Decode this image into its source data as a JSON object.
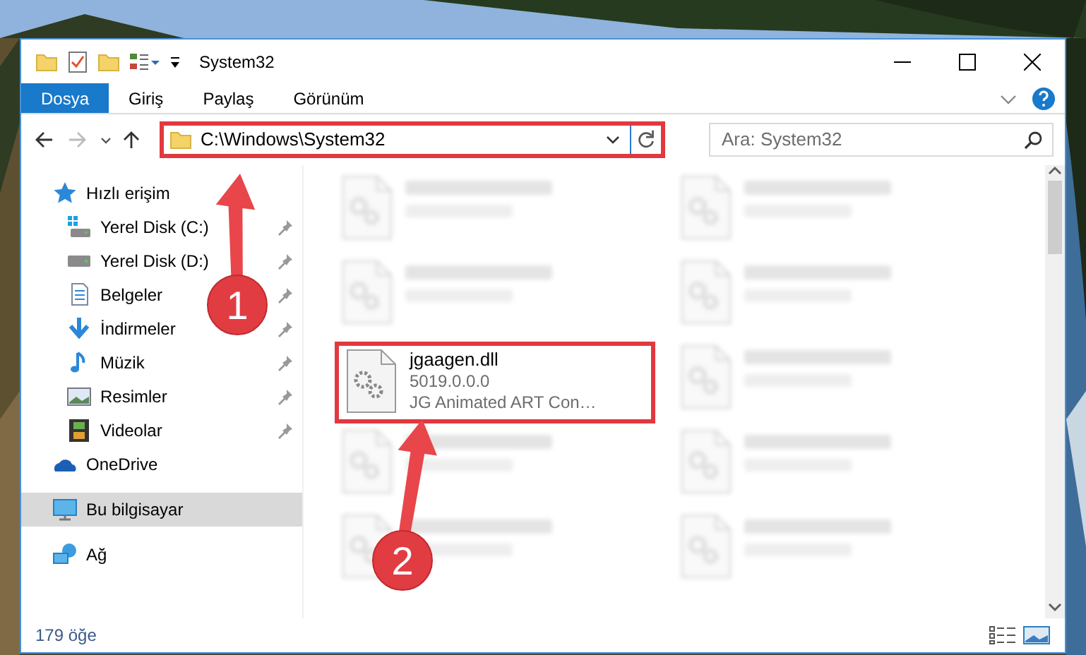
{
  "window": {
    "title": "System32"
  },
  "ribbon_tabs": [
    {
      "label": "Dosya",
      "selected": true
    },
    {
      "label": "Giriş",
      "selected": false
    },
    {
      "label": "Paylaş",
      "selected": false
    },
    {
      "label": "Görünüm",
      "selected": false
    }
  ],
  "address": {
    "path": "C:\\Windows\\System32",
    "highlighted": true
  },
  "search": {
    "placeholder": "Ara: System32"
  },
  "sidebar": {
    "items": [
      {
        "label": "Hızlı erişim",
        "kind": "star",
        "selected": false,
        "children": [
          {
            "label": "Yerel Disk (C:)",
            "kind": "drive-c",
            "pinned": true,
            "selected": false
          },
          {
            "label": "Yerel Disk (D:)",
            "kind": "drive",
            "pinned": true,
            "selected": false
          },
          {
            "label": "Belgeler",
            "kind": "document",
            "pinned": true,
            "selected": false
          },
          {
            "label": "İndirmeler",
            "kind": "download",
            "pinned": true,
            "selected": false
          },
          {
            "label": "Müzik",
            "kind": "music",
            "pinned": true,
            "selected": false
          },
          {
            "label": "Resimler",
            "kind": "pictures",
            "pinned": true,
            "selected": false
          },
          {
            "label": "Videolar",
            "kind": "video",
            "pinned": true,
            "selected": false
          }
        ]
      },
      {
        "label": "OneDrive",
        "kind": "cloud",
        "selected": false
      },
      {
        "label": "Bu bilgisayar",
        "kind": "pc",
        "selected": true
      },
      {
        "label": "Ağ",
        "kind": "network",
        "selected": false
      }
    ]
  },
  "files": [
    {
      "blurred": true,
      "highlighted": false
    },
    {
      "blurred": true,
      "highlighted": false
    },
    {
      "blurred": true,
      "highlighted": false
    },
    {
      "blurred": true,
      "highlighted": false
    },
    {
      "lines": [
        "jgaagen.dll",
        "5019.0.0.0",
        "JG Animated ART Con…"
      ],
      "blurred": false,
      "highlighted": true
    },
    {
      "blurred": true,
      "highlighted": false
    },
    {
      "blurred": true,
      "highlighted": false
    },
    {
      "blurred": true,
      "highlighted": false
    },
    {
      "blurred": true,
      "highlighted": false
    },
    {
      "blurred": true,
      "highlighted": false
    }
  ],
  "status_bar": {
    "count": "179 öğe"
  },
  "callouts": [
    {
      "number": "1"
    },
    {
      "number": "2"
    }
  ]
}
